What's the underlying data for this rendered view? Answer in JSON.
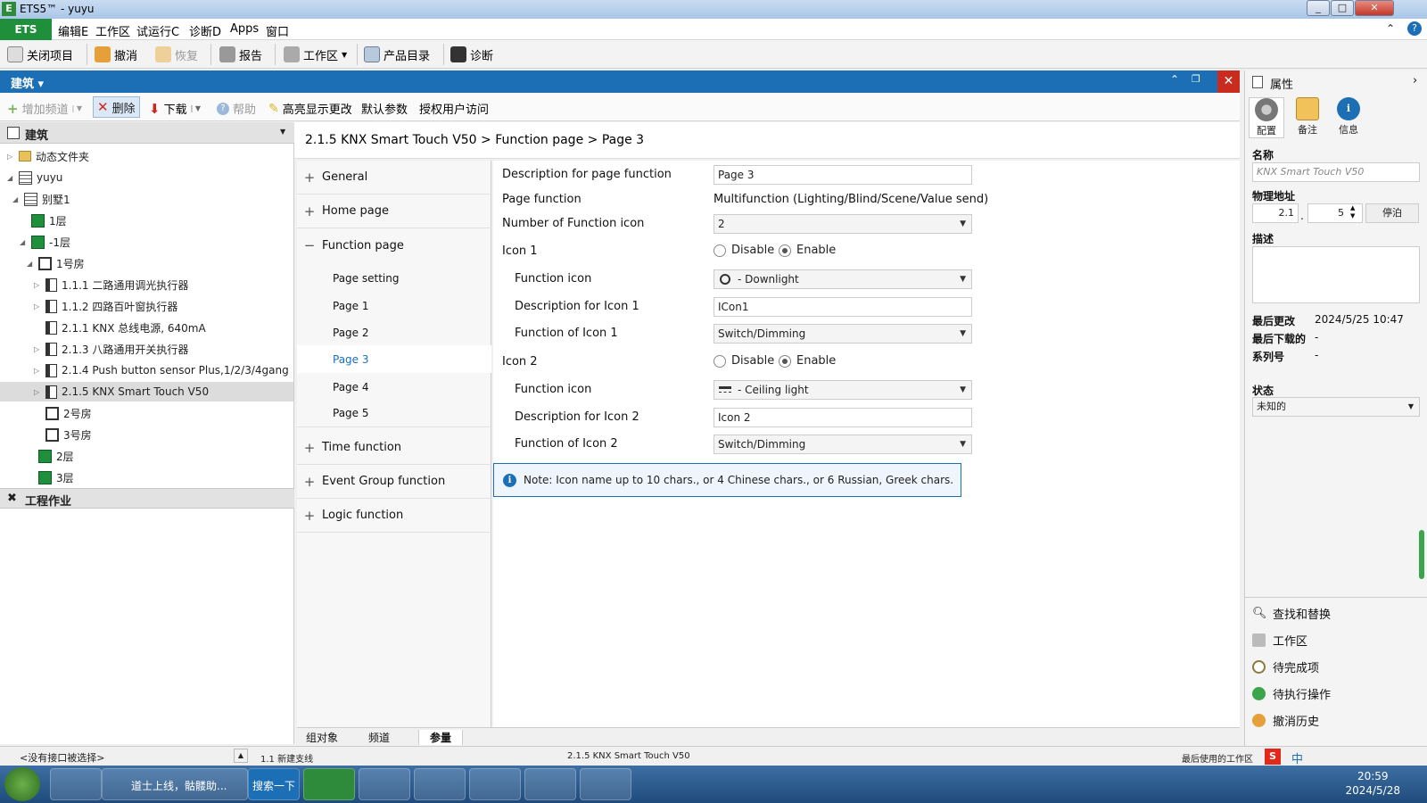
{
  "window": {
    "title": "ETS5™ - yuyu",
    "logo": "E"
  },
  "menubar": {
    "ets": "ETS",
    "items": [
      "编辑E",
      "工作区",
      "试运行C",
      "诊断D",
      "Apps",
      "窗口"
    ]
  },
  "toolbar": {
    "close_project": "关闭项目",
    "undo": "撤消",
    "redo": "恢复",
    "report": "报告",
    "workspace": "工作区",
    "catalog": "产品目录",
    "diagnostics": "诊断"
  },
  "panel": {
    "title": "建筑 ▾"
  },
  "subbar": {
    "add_channel": "增加频道",
    "delete": "删除",
    "download": "下载",
    "help": "帮助",
    "highlight": "高亮显示更改",
    "default_params": "默认参数",
    "authorize": "授权用户访问"
  },
  "tree": {
    "header": "建筑",
    "items": [
      {
        "label": "动态文件夹"
      },
      {
        "label": "yuyu"
      },
      {
        "label": "别墅1"
      },
      {
        "label": "1层"
      },
      {
        "label": "-1层"
      },
      {
        "label": "1号房"
      },
      {
        "label": "1.1.1 二路通用调光执行器"
      },
      {
        "label": "1.1.2 四路百叶窗执行器"
      },
      {
        "label": "2.1.1 KNX 总线电源, 640mA"
      },
      {
        "label": "2.1.3 八路通用开关执行器"
      },
      {
        "label": "2.1.4 Push button sensor Plus,1/2/3/4gang"
      },
      {
        "label": "2.1.5 KNX Smart Touch V50"
      },
      {
        "label": "2号房"
      },
      {
        "label": "3号房"
      },
      {
        "label": "2层"
      },
      {
        "label": "3层"
      }
    ],
    "work": "工程作业"
  },
  "breadcrumb": "2.1.5 KNX Smart Touch V50 > Function page  > Page 3",
  "nav": {
    "general": "General",
    "home": "Home page",
    "function": "Function page",
    "subs": [
      "Page setting",
      "Page 1",
      "Page 2",
      "Page 3",
      "Page 4",
      "Page 5"
    ],
    "time": "Time function",
    "event": "Event Group function",
    "logic": "Logic function"
  },
  "params": {
    "desc_label": "Description for page function",
    "desc_value": "Page 3",
    "pf_label": "Page function",
    "pf_value": "Multifunction (Lighting/Blind/Scene/Value send)",
    "num_label": "Number of  Function icon",
    "num_value": "2",
    "icon1": "Icon 1",
    "disable": "Disable",
    "enable": "Enable",
    "fi_label": "Function icon",
    "fi1_value": "- Downlight",
    "d1_label": "Description for Icon 1",
    "d1_value": "ICon1",
    "f1_label": "Function of Icon 1",
    "f1_value": "Switch/Dimming",
    "icon2": "Icon 2",
    "fi2_value": "- Ceiling light",
    "d2_label": "Description for Icon 2",
    "d2_value": "Icon 2",
    "f2_label": "Function of Icon 2",
    "f2_value": "Switch/Dimming",
    "note": "Note: Icon name up to 10 chars., or 4 Chinese chars., or 6 Russian, Greek chars."
  },
  "bottomtabs": [
    "组对象",
    "频道",
    "参量"
  ],
  "props": {
    "title": "属性",
    "tabs": [
      "配置",
      "备注",
      "信息"
    ],
    "name_label": "名称",
    "name_value": "KNX Smart Touch V50",
    "addr_label": "物理地址",
    "addr_a": "2.1",
    "addr_b": "5",
    "park": "停泊",
    "desc_label": "描述",
    "last_mod_label": "最后更改",
    "last_mod_value": "2024/5/25 10:47",
    "last_dl_label": "最后下载的",
    "last_dl_value": "-",
    "serial_label": "系列号",
    "serial_value": "-",
    "state_label": "状态",
    "state_value": "未知的",
    "links": [
      "查找和替换",
      "工作区",
      "待完成项",
      "待执行操作",
      "撤消历史"
    ]
  },
  "status": {
    "iface": "<没有接口被选择>",
    "line": "1.1 新建支线",
    "device": "2.1.5 KNX Smart Touch V50",
    "last_ws": "最后使用的工作区"
  },
  "taskbar": {
    "ie": "道士上线，骷髅助...",
    "search": "搜索一下",
    "time": "20:59",
    "date": "2024/5/28",
    "ime": "中"
  },
  "colors": {
    "accent": "#1c6fb5",
    "ets_green": "#1f8f3b",
    "close_red": "#c92b1e"
  }
}
